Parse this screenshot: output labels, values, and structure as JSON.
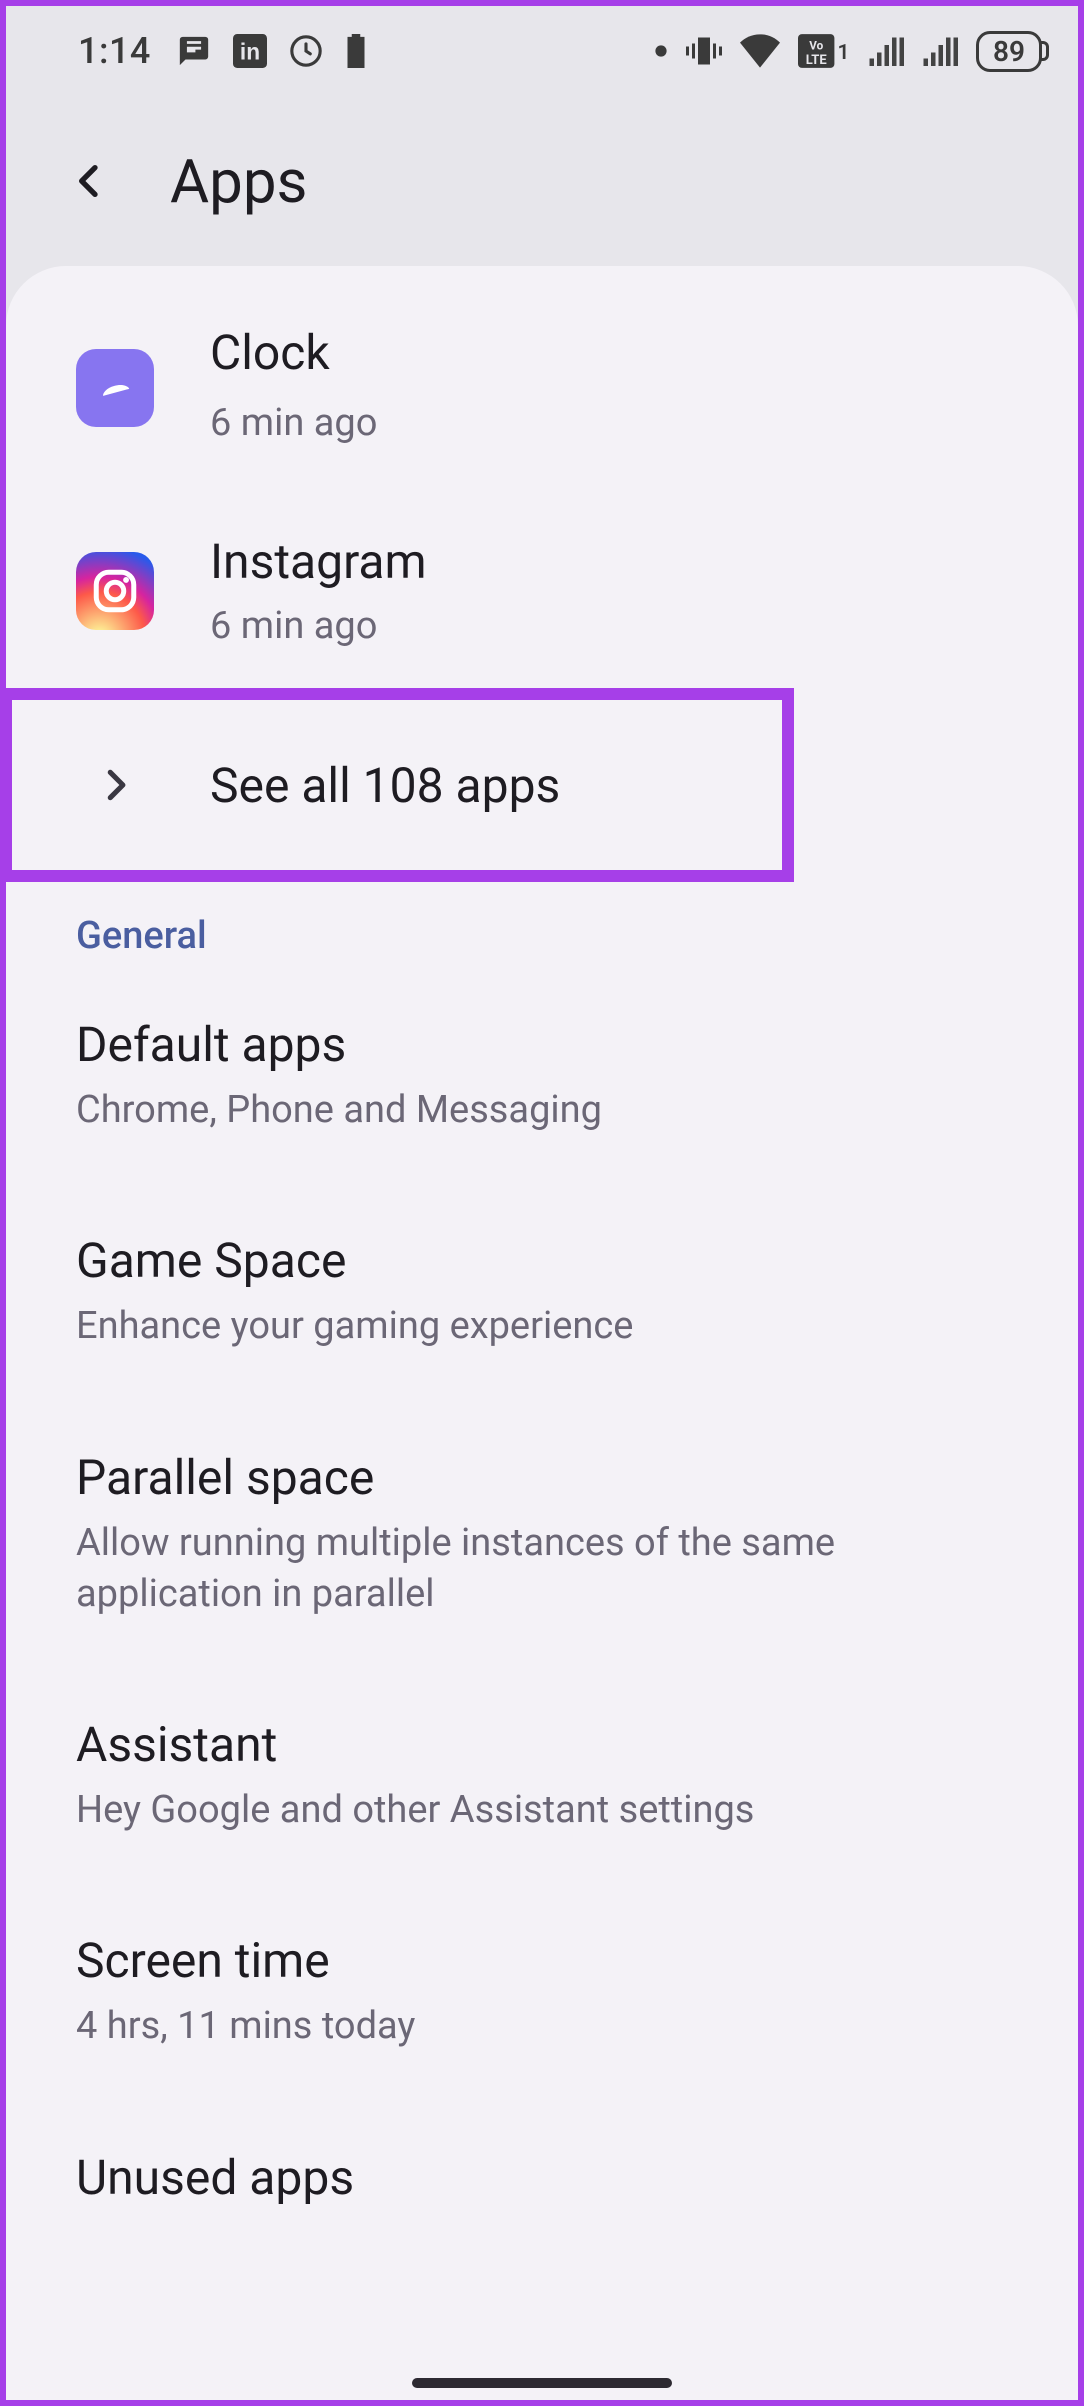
{
  "status": {
    "time": "1:14",
    "battery": "89"
  },
  "header": {
    "title": "Apps"
  },
  "recent": [
    {
      "name": "Clock",
      "sub": "6 min ago",
      "icon": "clock"
    },
    {
      "name": "Instagram",
      "sub": "6 min ago",
      "icon": "instagram"
    }
  ],
  "see_all": "See all 108 apps",
  "general_label": "General",
  "general": [
    {
      "name": "Default apps",
      "sub": "Chrome, Phone and Messaging"
    },
    {
      "name": "Game Space",
      "sub": "Enhance your gaming experience"
    },
    {
      "name": "Parallel space",
      "sub": "Allow running multiple instances of the same application in parallel"
    },
    {
      "name": "Assistant",
      "sub": "Hey Google and other Assistant settings"
    },
    {
      "name": "Screen time",
      "sub": "4 hrs, 11 mins today"
    },
    {
      "name": "Unused apps",
      "sub": ""
    }
  ]
}
